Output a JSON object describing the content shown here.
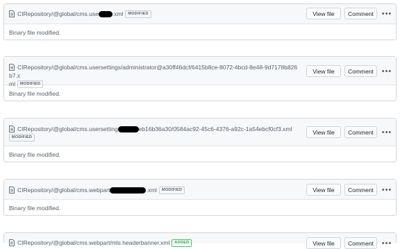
{
  "buttons": {
    "view_file": "View file",
    "comment": "Comment",
    "more": "•••"
  },
  "files": [
    {
      "path_start": "CIRepository/@global/cms.use",
      "path_end": ".xml",
      "badge": "MODIFIED",
      "body": "Binary file modified."
    },
    {
      "path_line1": "CIRepository/@global/cms.usersettings/administrator@a30ff46dcf/6415b8ce-8072-4bcd-8e48-9d7178b826b7.x",
      "path_line2": "ml",
      "badge": "MODIFIED",
      "body": "Binary file modified."
    },
    {
      "path_start": "CIRepository/@global/cms.usersetting",
      "path_end": "eb16b36a30/0584ac92-45c6-4376-a92c-1a54ebcf0cf3.xml",
      "badge": "MODIFIED",
      "body": "Binary file modified."
    },
    {
      "path_start": "CIRepository/@global/cms.webpart",
      "path_end": ".xml",
      "badge": "MODIFIED",
      "body": "Binary file modified."
    },
    {
      "path": "CIRepository/@global/cms.webpart/mls.headerbanner.xml",
      "badge": "ADDED"
    }
  ]
}
